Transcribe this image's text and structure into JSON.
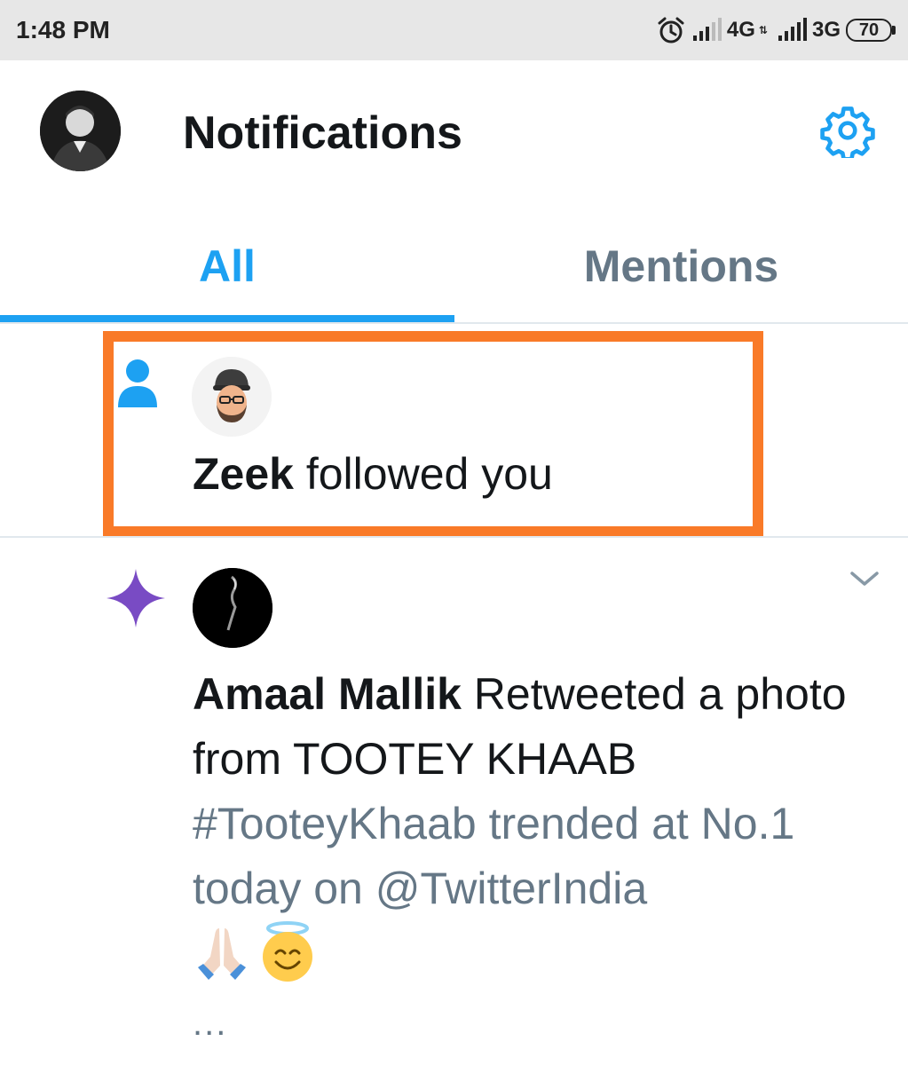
{
  "status_bar": {
    "time": "1:48 PM",
    "network_1": "4G",
    "network_2": "3G",
    "battery": "70",
    "icons": [
      "alarm-icon",
      "signal-icon",
      "signal-icon",
      "battery-icon"
    ]
  },
  "header": {
    "title": "Notifications",
    "icons": [
      "profile-avatar",
      "gear-icon"
    ]
  },
  "tabs": [
    {
      "label": "All",
      "selected": true
    },
    {
      "label": "Mentions",
      "selected": false
    }
  ],
  "notifications": [
    {
      "type": "follow",
      "icon": "person-icon",
      "user": "Zeek",
      "action": " followed you",
      "highlighted": true
    },
    {
      "type": "retweet",
      "icon": "sparkle-icon",
      "user": "Amaal Mallik",
      "action": " Retweeted a photo from TOOTEY KHAAB",
      "body": "#TooteyKhaab trended at No.1 today on @TwitterIndia",
      "emojis": [
        "folded-hands-emoji",
        "smiling-halo-emoji"
      ],
      "more": "..."
    }
  ],
  "colors": {
    "accent": "#1da1f2",
    "highlight": "#f97a28",
    "muted": "#657786",
    "sparkle": "#794bc4"
  }
}
